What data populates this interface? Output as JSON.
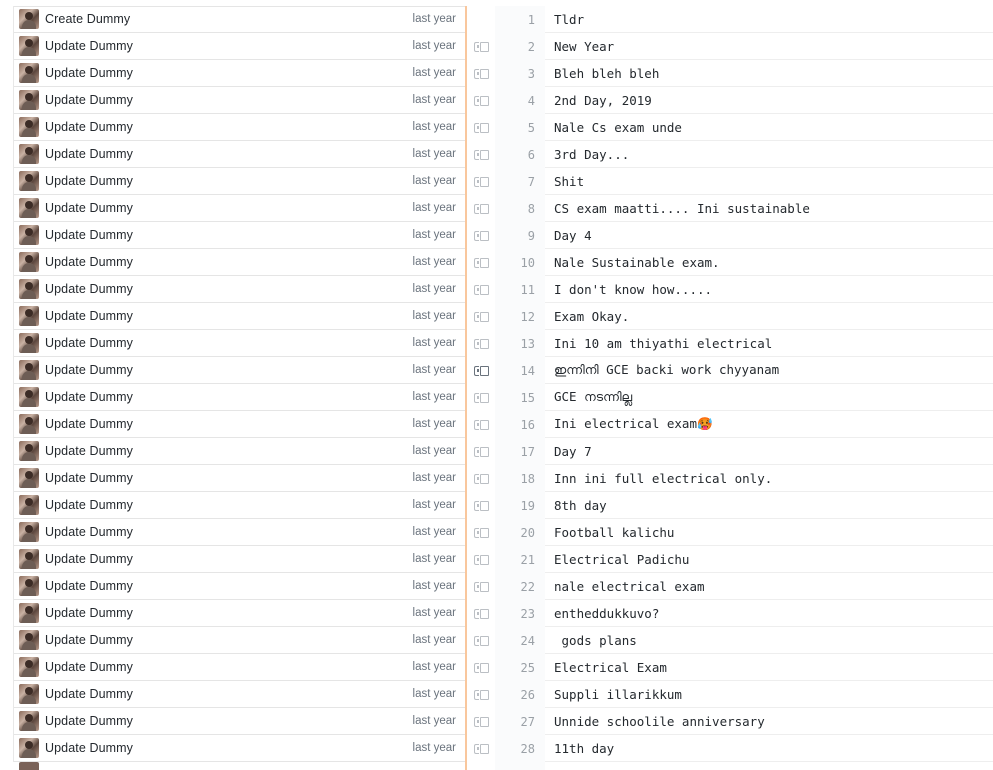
{
  "blame": {
    "rows": [
      {
        "commit": "Create Dummy",
        "time": "last year",
        "line": "1",
        "code": "Tldr",
        "reblame": false
      },
      {
        "commit": "Update Dummy",
        "time": "last year",
        "line": "2",
        "code": "New Year",
        "reblame": true
      },
      {
        "commit": "Update Dummy",
        "time": "last year",
        "line": "3",
        "code": "Bleh bleh bleh",
        "reblame": true
      },
      {
        "commit": "Update Dummy",
        "time": "last year",
        "line": "4",
        "code": "2nd Day, 2019",
        "reblame": true
      },
      {
        "commit": "Update Dummy",
        "time": "last year",
        "line": "5",
        "code": "Nale Cs exam unde",
        "reblame": true
      },
      {
        "commit": "Update Dummy",
        "time": "last year",
        "line": "6",
        "code": "3rd Day...",
        "reblame": true
      },
      {
        "commit": "Update Dummy",
        "time": "last year",
        "line": "7",
        "code": "Shit",
        "reblame": true
      },
      {
        "commit": "Update Dummy",
        "time": "last year",
        "line": "8",
        "code": "CS exam maatti.... Ini sustainable",
        "reblame": true
      },
      {
        "commit": "Update Dummy",
        "time": "last year",
        "line": "9",
        "code": "Day 4",
        "reblame": true
      },
      {
        "commit": "Update Dummy",
        "time": "last year",
        "line": "10",
        "code": "Nale Sustainable exam.",
        "reblame": true
      },
      {
        "commit": "Update Dummy",
        "time": "last year",
        "line": "11",
        "code": "I don't know how.....",
        "reblame": true
      },
      {
        "commit": "Update Dummy",
        "time": "last year",
        "line": "12",
        "code": "Exam Okay.",
        "reblame": true
      },
      {
        "commit": "Update Dummy",
        "time": "last year",
        "line": "13",
        "code": "Ini 10 am thiyathi electrical",
        "reblame": true
      },
      {
        "commit": "Update Dummy",
        "time": "last year",
        "line": "14",
        "code": "ഇന്നിനി GCE backi work chyyanam",
        "reblame": true,
        "hover": true
      },
      {
        "commit": "Update Dummy",
        "time": "last year",
        "line": "15",
        "code": "GCE നടന്നില്ല",
        "reblame": true
      },
      {
        "commit": "Update Dummy",
        "time": "last year",
        "line": "16",
        "code": "Ini electrical exam🥵",
        "reblame": true
      },
      {
        "commit": "Update Dummy",
        "time": "last year",
        "line": "17",
        "code": "Day 7",
        "reblame": true
      },
      {
        "commit": "Update Dummy",
        "time": "last year",
        "line": "18",
        "code": "Inn ini full electrical only.",
        "reblame": true
      },
      {
        "commit": "Update Dummy",
        "time": "last year",
        "line": "19",
        "code": "8th day",
        "reblame": true
      },
      {
        "commit": "Update Dummy",
        "time": "last year",
        "line": "20",
        "code": "Football kalichu",
        "reblame": true
      },
      {
        "commit": "Update Dummy",
        "time": "last year",
        "line": "21",
        "code": "Electrical Padichu",
        "reblame": true
      },
      {
        "commit": "Update Dummy",
        "time": "last year",
        "line": "22",
        "code": "nale electrical exam",
        "reblame": true
      },
      {
        "commit": "Update Dummy",
        "time": "last year",
        "line": "23",
        "code": "entheddukkuvo?",
        "reblame": true
      },
      {
        "commit": "Update Dummy",
        "time": "last year",
        "line": "24",
        "code": " gods plans",
        "reblame": true
      },
      {
        "commit": "Update Dummy",
        "time": "last year",
        "line": "25",
        "code": "Electrical Exam",
        "reblame": true
      },
      {
        "commit": "Update Dummy",
        "time": "last year",
        "line": "26",
        "code": "Suppli illarikkum",
        "reblame": true
      },
      {
        "commit": "Update Dummy",
        "time": "last year",
        "line": "27",
        "code": "Unnide schoolile anniversary",
        "reblame": true
      },
      {
        "commit": "Update Dummy",
        "time": "last year",
        "line": "28",
        "code": "11th day",
        "reblame": true
      }
    ]
  },
  "icons": {
    "avatar": "user-avatar",
    "reblame": "reblame-icon"
  },
  "colors": {
    "heat_bar": "#f9c79d",
    "commit_text": "#24292e",
    "time_text": "#6a737d",
    "line_number": "#9aa0a6"
  }
}
